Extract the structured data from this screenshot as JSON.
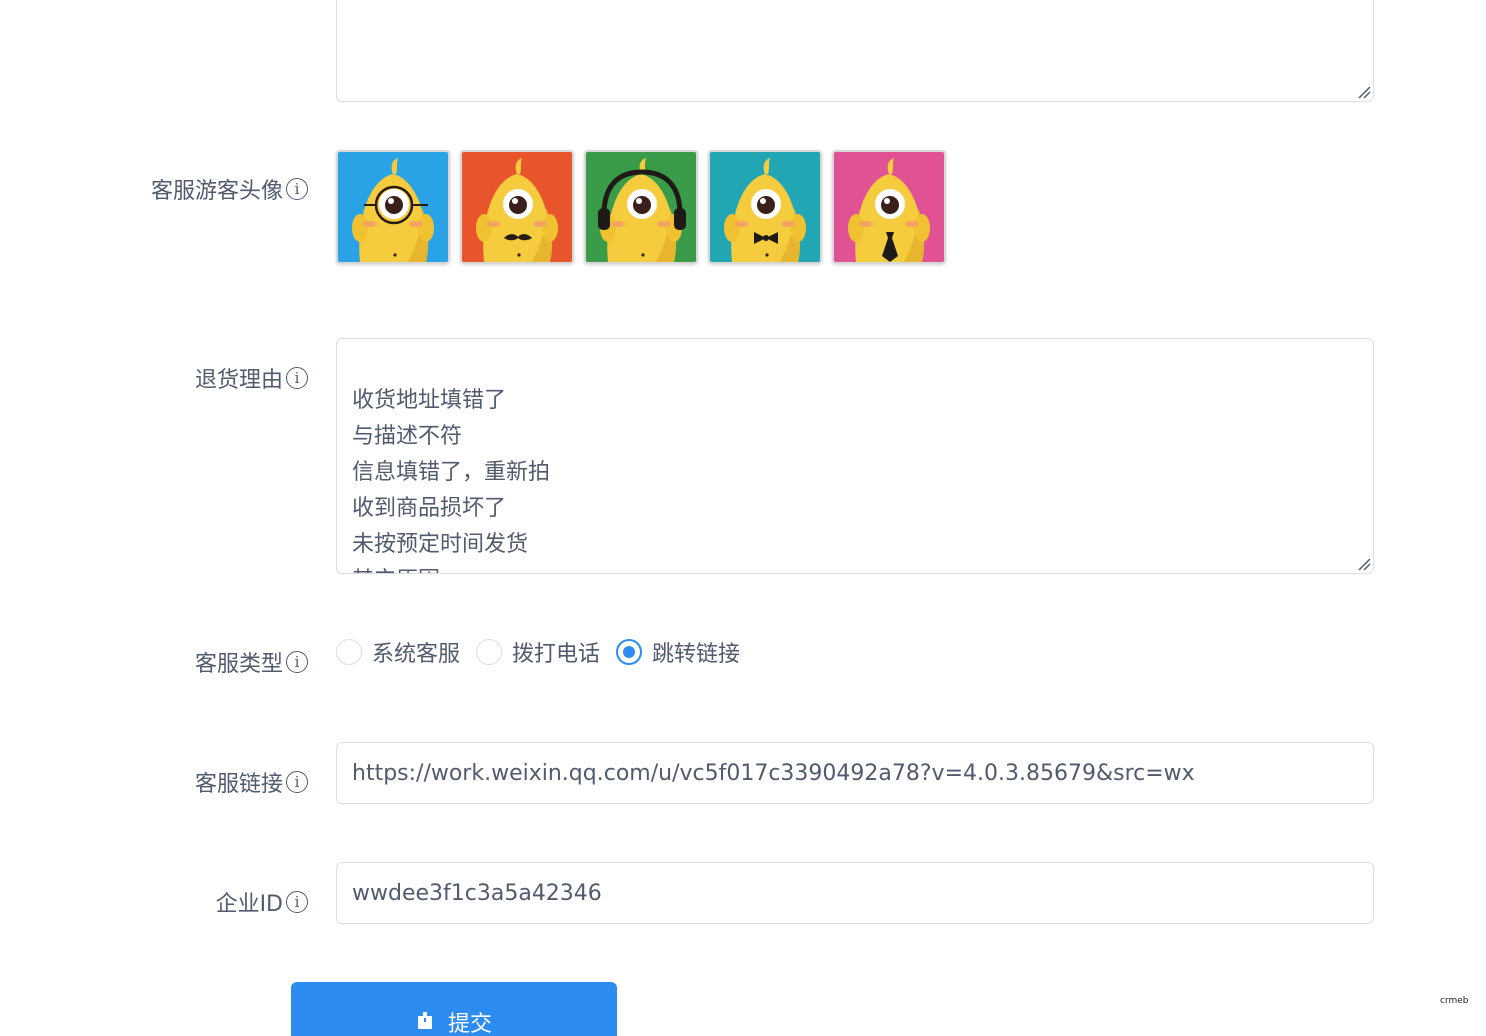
{
  "form": {
    "top_textarea": {
      "value": ""
    },
    "avatar": {
      "label": "客服游客头像",
      "items": [
        {
          "name": "monocle",
          "bg": "#2aa3e6"
        },
        {
          "name": "mustache",
          "bg": "#e8552d"
        },
        {
          "name": "headphones",
          "bg": "#3a9b48"
        },
        {
          "name": "bowtie",
          "bg": "#22a6b3"
        },
        {
          "name": "necktie",
          "bg": "#e05294"
        }
      ]
    },
    "return_reason": {
      "label": "退货理由",
      "value": "收货地址填错了\n与描述不符\n信息填错了，重新拍\n收到商品损坏了\n未按预定时间发货\n其它原因"
    },
    "service_type": {
      "label": "客服类型",
      "options": [
        "系统客服",
        "拨打电话",
        "跳转链接"
      ],
      "selected": "跳转链接"
    },
    "service_link": {
      "label": "客服链接",
      "value": "https://work.weixin.qq.com/u/vc5f017c3390492a78?v=4.0.3.85679&src=wx"
    },
    "corp_id": {
      "label": "企业ID",
      "value": "wwdee3f1c3a5a42346"
    },
    "submit_label": "提交"
  },
  "watermark": "crmeb",
  "colors": {
    "primary": "#2d8cf0",
    "text": "#515a6e",
    "border": "#dcdee2"
  }
}
